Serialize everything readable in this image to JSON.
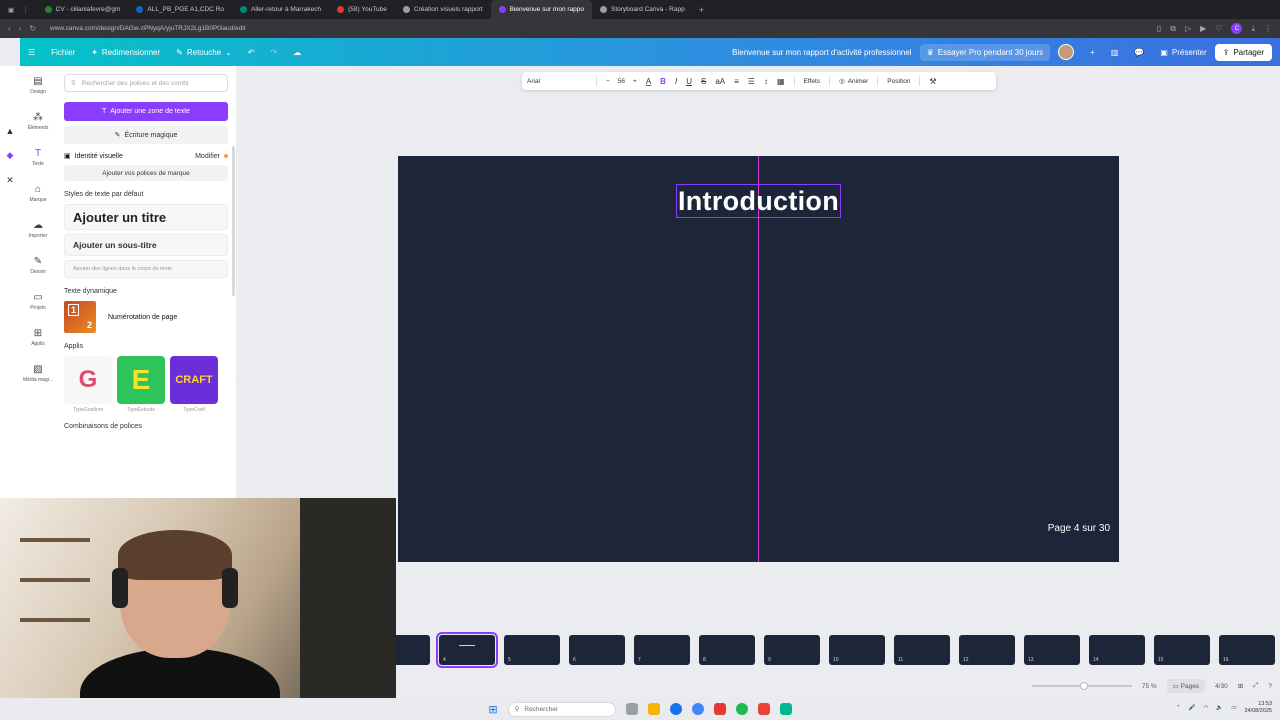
{
  "browser": {
    "tabs": [
      {
        "label": "CV - cilianlafevre@gm",
        "color": "#2e7d32",
        "active": false
      },
      {
        "label": "ALL_PB_PGE A1,CDC Ro",
        "color": "#1565c0",
        "active": false
      },
      {
        "label": "Aller-retour à Marrakech",
        "color": "#00897b",
        "active": false
      },
      {
        "label": "(58) YouTube",
        "color": "#e53935",
        "active": false
      },
      {
        "label": "Création visuels rapport",
        "color": "#9e9e9e",
        "active": false
      },
      {
        "label": "Bienvenue sur mon rappo",
        "color": "#8b3dff",
        "active": true
      },
      {
        "label": "Storyboard Canva - Rapp",
        "color": "#9e9e9e",
        "active": false
      }
    ],
    "url": "www.canva.com/design/DAGw-zPNyqA/yjuTRJX2Lg1B0P0iaud/edit"
  },
  "topbar": {
    "file": "Fichier",
    "resize": "Redimensionner",
    "retouch": "Retouche",
    "doc_title": "Bienvenue sur mon rapport d'activité professionnel",
    "pro_trial": "Essayer Pro pendant 30 jours",
    "present": "Présenter",
    "share": "Partager"
  },
  "rail": {
    "items": [
      {
        "label": "Design",
        "icon": "layout-icon"
      },
      {
        "label": "Éléments",
        "icon": "elements-icon"
      },
      {
        "label": "Texte",
        "icon": "text-icon"
      },
      {
        "label": "Marque",
        "icon": "brand-icon"
      },
      {
        "label": "Importer",
        "icon": "upload-icon"
      },
      {
        "label": "Dessin",
        "icon": "draw-icon"
      },
      {
        "label": "Projets",
        "icon": "folder-icon"
      },
      {
        "label": "Applis",
        "icon": "apps-icon"
      },
      {
        "label": "Média magi...",
        "icon": "magic-media-icon"
      }
    ]
  },
  "panel": {
    "search_placeholder": "Rechercher des polices et des combi",
    "add_text": "Ajouter une zone de texte",
    "magic_write": "Écriture magique",
    "brand_identity": "Identité visuelle",
    "modify": "Modifier",
    "add_brand_fonts": "Ajouter vos polices de marque",
    "default_styles": "Styles de texte par défaut",
    "add_title": "Ajouter un titre",
    "add_subtitle": "Ajouter un sous-titre",
    "add_body": "Ajouter des lignes dans le corps du texte",
    "dynamic_text": "Texte dynamique",
    "page_numbering": "Numérotation de page",
    "apps_label": "Applis",
    "apps": [
      {
        "label": "TypeGradient",
        "glyph": "G"
      },
      {
        "label": "TypeExtrude",
        "glyph": "E"
      },
      {
        "label": "TypeCraft",
        "glyph": "CRAFT"
      }
    ],
    "font_combos": "Combinaisons de polices"
  },
  "text_toolbar": {
    "font": "Arial",
    "size": "56",
    "effects": "Effets",
    "animate": "Animer",
    "position": "Position"
  },
  "page": {
    "title": "Introduction",
    "page_number": "Page 4 sur 30",
    "background": "#1d2638"
  },
  "thumbnails": [
    "",
    "4",
    "5",
    "6",
    "7",
    "8",
    "9",
    "10",
    "11",
    "12",
    "13",
    "14",
    "15",
    "16"
  ],
  "statusbar": {
    "zoom": "75 %",
    "pages": "Pages",
    "page_count": "4/30"
  },
  "taskbar": {
    "search": "Rechercher",
    "time": "13:53",
    "date": "24/08/2025"
  }
}
